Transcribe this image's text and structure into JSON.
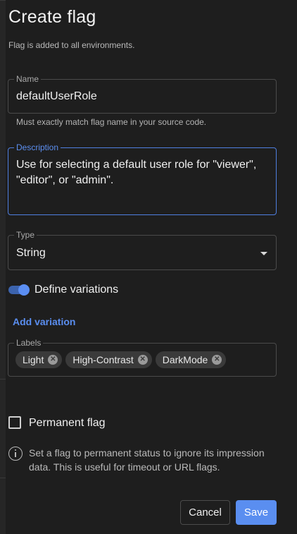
{
  "dialog": {
    "title": "Create flag",
    "subtitle": "Flag is added to all environments."
  },
  "name_field": {
    "label": "Name",
    "value": "defaultUserRole",
    "helper": "Must exactly match flag name in your source code."
  },
  "description_field": {
    "label": "Description",
    "value": "Use for selecting a default user role for \"viewer\", \"editor\", or \"admin\"."
  },
  "type_field": {
    "label": "Type",
    "value": "String"
  },
  "variations": {
    "toggle_label": "Define variations",
    "enabled": true,
    "add_label": "Add variation"
  },
  "labels_field": {
    "label": "Labels",
    "chips": [
      {
        "label": "Light"
      },
      {
        "label": "High-Contrast"
      },
      {
        "label": "DarkMode"
      }
    ]
  },
  "permanent": {
    "label": "Permanent flag",
    "checked": false,
    "info": "Set a flag to permanent status to ignore its impression data. This is useful for timeout or URL flags."
  },
  "actions": {
    "cancel": "Cancel",
    "save": "Save"
  },
  "colors": {
    "accent": "#5a8ef0",
    "background": "#1e1e1e"
  }
}
